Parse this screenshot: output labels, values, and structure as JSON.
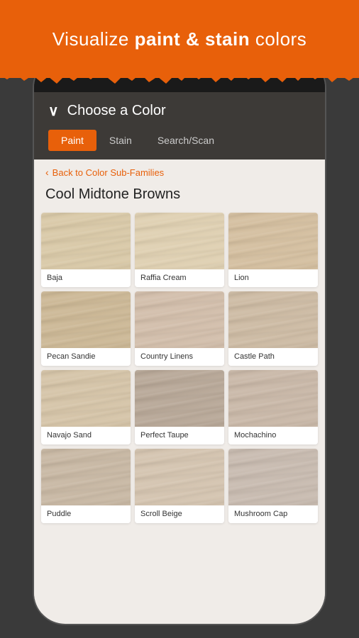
{
  "banner": {
    "text_plain": "Visualize ",
    "text_bold": "paint & stain",
    "text_end": " colors"
  },
  "app": {
    "header_title": "Choose a Color",
    "chevron": "∨"
  },
  "tabs": [
    {
      "label": "Paint",
      "active": true
    },
    {
      "label": "Stain",
      "active": false
    },
    {
      "label": "Search/Scan",
      "active": false
    }
  ],
  "back_link": "Back to Color Sub-Families",
  "section_title": "Cool Midtone Browns",
  "colors": [
    {
      "name": "Baja",
      "swatch": "#d9c9a8"
    },
    {
      "name": "Raffia Cream",
      "swatch": "#dfd0b2"
    },
    {
      "name": "Lion",
      "swatch": "#d4bfa0"
    },
    {
      "name": "Pecan Sandie",
      "swatch": "#ccb896"
    },
    {
      "name": "Country Linens",
      "swatch": "#d2beab"
    },
    {
      "name": "Castle Path",
      "swatch": "#cdbba4"
    },
    {
      "name": "Navajo Sand",
      "swatch": "#d5c4a8"
    },
    {
      "name": "Perfect Taupe",
      "swatch": "#b8a898"
    },
    {
      "name": "Mochachino",
      "swatch": "#c9b8a8"
    },
    {
      "name": "Puddle",
      "swatch": "#c8b8a4"
    },
    {
      "name": "Scroll Beige",
      "swatch": "#d4c4b0"
    },
    {
      "name": "Mushroom Cap",
      "swatch": "#c8bbb0"
    }
  ],
  "accent_color": "#e8600a"
}
